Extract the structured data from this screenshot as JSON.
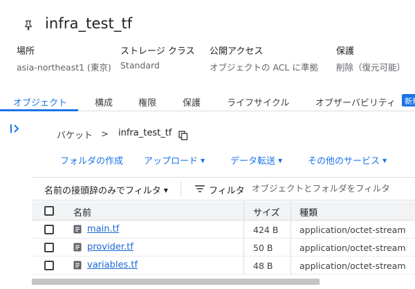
{
  "bucket": {
    "title": "infra_test_tf",
    "pin_icon": "pin-icon"
  },
  "meta": [
    {
      "label": "場所",
      "value": "asia-northeast1 (東京)"
    },
    {
      "label": "ストレージ クラス",
      "value": "Standard"
    },
    {
      "label": "公開アクセス",
      "value": "オブジェクトの ACL に準拠"
    },
    {
      "label": "保護",
      "value": "削除（復元可能）"
    }
  ],
  "tabs": [
    {
      "label": "オブジェクト",
      "active": true
    },
    {
      "label": "構成"
    },
    {
      "label": "権限"
    },
    {
      "label": "保護"
    },
    {
      "label": "ライフサイクル"
    },
    {
      "label": "オブザーバビリティ"
    }
  ],
  "new_badge": "新規",
  "breadcrumb": {
    "root": "バケット",
    "separator": ">",
    "current": "infra_test_tf"
  },
  "actions": {
    "create_folder": "フォルダの作成",
    "upload": "アップロード",
    "transfer": "データ転送",
    "other_services": "その他のサービス"
  },
  "filter": {
    "prefix": "名前の接頭辞のみでフィルタ",
    "label": "フィルタ",
    "placeholder": "オブジェクトとフォルダをフィルタ"
  },
  "table": {
    "headers": {
      "name": "名前",
      "size": "サイズ",
      "type": "種類"
    },
    "rows": [
      {
        "name": "main.tf",
        "size": "424 B",
        "type": "application/octet-stream"
      },
      {
        "name": "provider.tf",
        "size": "50 B",
        "type": "application/octet-stream"
      },
      {
        "name": "variables.tf",
        "size": "48 B",
        "type": "application/octet-stream"
      }
    ]
  },
  "colors": {
    "accent": "#1a73e8",
    "text": "#202124",
    "muted": "#5f6368"
  }
}
